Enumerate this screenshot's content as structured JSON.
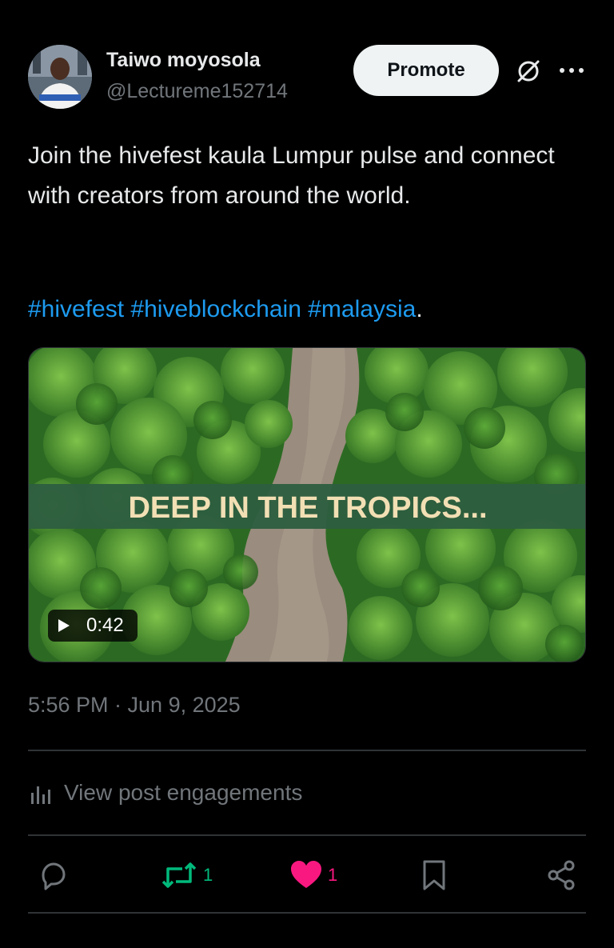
{
  "post": {
    "author_name": "Taiwo moyosola",
    "author_handle": "@Lectureme152714",
    "body": "Join the hivefest kaula Lumpur pulse and connect with creators from around the world.",
    "hashtags": [
      "#hivefest",
      "#hiveblockchain",
      "#malaysia"
    ],
    "hashtag_trailing": ".",
    "timestamp": "5:56 PM · Jun 9, 2025"
  },
  "header": {
    "promote_label": "Promote",
    "grok_icon": "grok-slash-circle-icon",
    "more_icon": "more-dots-icon"
  },
  "media": {
    "banner_text": "DEEP IN THE TROPICS...",
    "duration": "0:42",
    "banner_color": "#2e5e40",
    "banner_text_color": "#f2dfb4"
  },
  "engagements": {
    "label": "View post engagements",
    "icon": "bar-chart-icon"
  },
  "actions": {
    "reply_count": "",
    "repost_count": "1",
    "like_count": "1",
    "repost_color": "#00ba7c",
    "like_color": "#f91880"
  },
  "colors": {
    "background": "#000000",
    "text_primary": "#e7e9ea",
    "text_secondary": "#71767b",
    "link": "#1d9bf0",
    "divider": "#2f3336"
  }
}
